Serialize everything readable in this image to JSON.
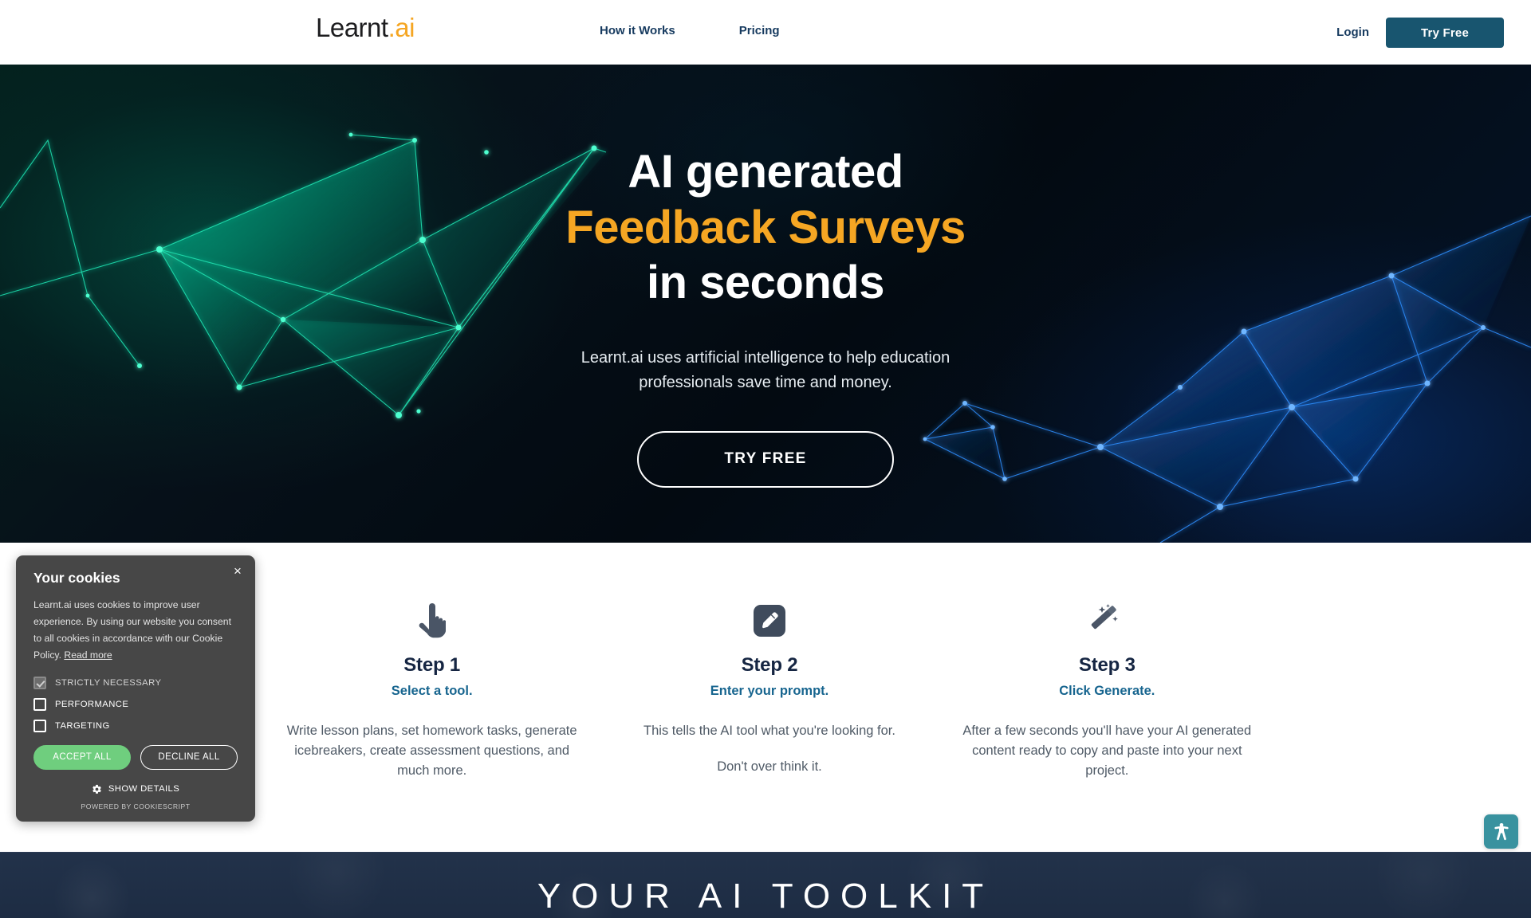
{
  "header": {
    "logo_main": "Learnt",
    "logo_accent": ".ai",
    "nav": [
      {
        "label": "How it Works"
      },
      {
        "label": "Pricing"
      }
    ],
    "login_label": "Login",
    "try_free_label": "Try Free",
    "accent_color": "#f5a623",
    "button_color": "#18556f",
    "nav_color": "#163a5f"
  },
  "hero": {
    "title_line1": "AI generated",
    "title_line2": "Feedback Surveys",
    "title_line3": "in seconds",
    "subtitle_line1": "Learnt.ai uses artificial intelligence to help education",
    "subtitle_line2": "professionals save time and money.",
    "cta_label": "TRY FREE",
    "accent_color": "#f5a623",
    "background_color": "#050d14",
    "mesh_green": "#0fd9a3",
    "mesh_blue": "#1f7ef0"
  },
  "steps": [
    {
      "icon": "pointing-hand-icon",
      "title": "Step 1",
      "subtitle": "Select a tool.",
      "body": [
        "Write lesson plans, set homework tasks, generate icebreakers, create assessment questions, and much more."
      ]
    },
    {
      "icon": "pencil-edit-icon",
      "title": "Step 2",
      "subtitle": "Enter your prompt.",
      "body": [
        "This tells the AI tool what you're looking for.",
        "Don't over think it."
      ]
    },
    {
      "icon": "magic-wand-icon",
      "title": "Step 3",
      "subtitle": "Click Generate.",
      "body": [
        "After a few seconds you'll have your AI generated content ready to copy and paste into your next project."
      ]
    }
  ],
  "toolkit": {
    "title": "YOUR AI TOOLKIT"
  },
  "cookie_dialog": {
    "title": "Your cookies",
    "body": "Learnt.ai uses cookies to improve user experience. By using our website you consent to all cookies in accordance with our Cookie Policy.",
    "read_more_label": "Read more",
    "close_label": "×",
    "options": [
      {
        "label": "STRICTLY NECESSARY",
        "checked": true,
        "disabled": true
      },
      {
        "label": "PERFORMANCE",
        "checked": false,
        "disabled": false
      },
      {
        "label": "TARGETING",
        "checked": false,
        "disabled": false
      }
    ],
    "accept_label": "ACCEPT ALL",
    "decline_label": "DECLINE ALL",
    "show_details_label": "SHOW DETAILS",
    "powered_by": "POWERED BY COOKIESCRIPT",
    "accept_color": "#6fce7e",
    "panel_color": "#474747"
  },
  "accessibility": {
    "icon": "accessibility-person-icon",
    "color": "#39929f"
  }
}
